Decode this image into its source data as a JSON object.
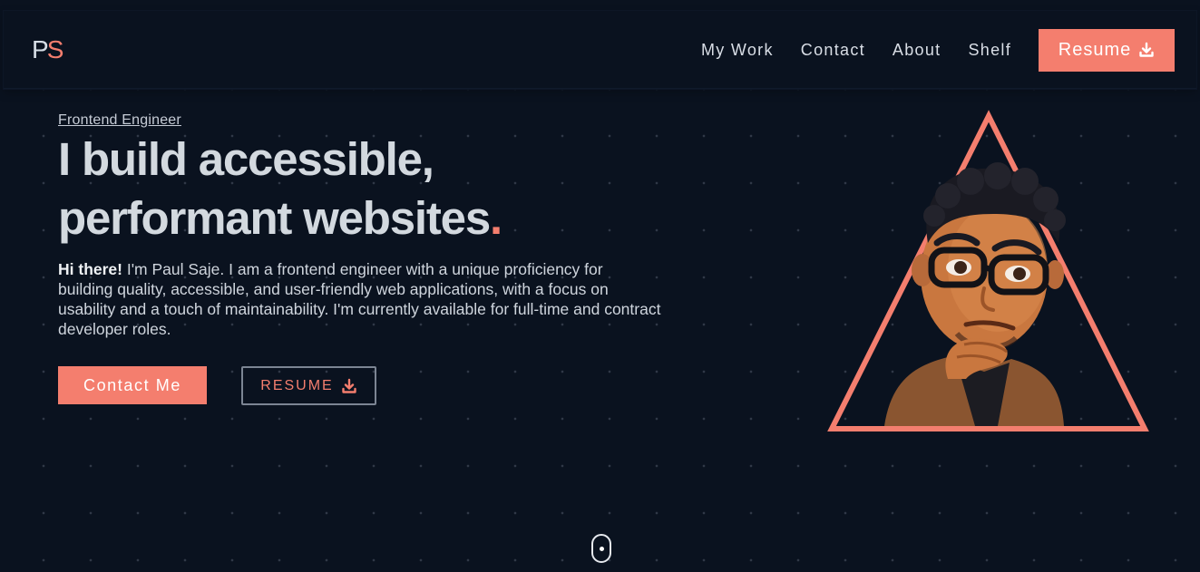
{
  "nav": {
    "logo_p": "P",
    "logo_s": "S",
    "links": [
      "My Work",
      "Contact",
      "About",
      "Shelf"
    ],
    "resume_label": "Resume",
    "resume_icon": "download-icon"
  },
  "hero": {
    "eyebrow": "Frontend Engineer",
    "headline_line1": "I build accessible,",
    "headline_line2": "performant websites",
    "headline_dot": ".",
    "intro_bold": "Hi there!",
    "intro_text": " I'm Paul Saje. I am a frontend engineer with a unique proficiency for building quality, accessible, and user-friendly web applications, with a focus on usability and a touch of maintainability. I'm currently available for full-time and contract developer roles.",
    "contact_label": "Contact Me",
    "resume_label": "RESUME",
    "resume_icon": "download-icon"
  },
  "illustration": {
    "subject": "avatar-illustration",
    "frame": "triangle-outline"
  },
  "colors": {
    "background": "#0a121f",
    "accent": "#f47e6e",
    "text": "#d3d9df"
  }
}
